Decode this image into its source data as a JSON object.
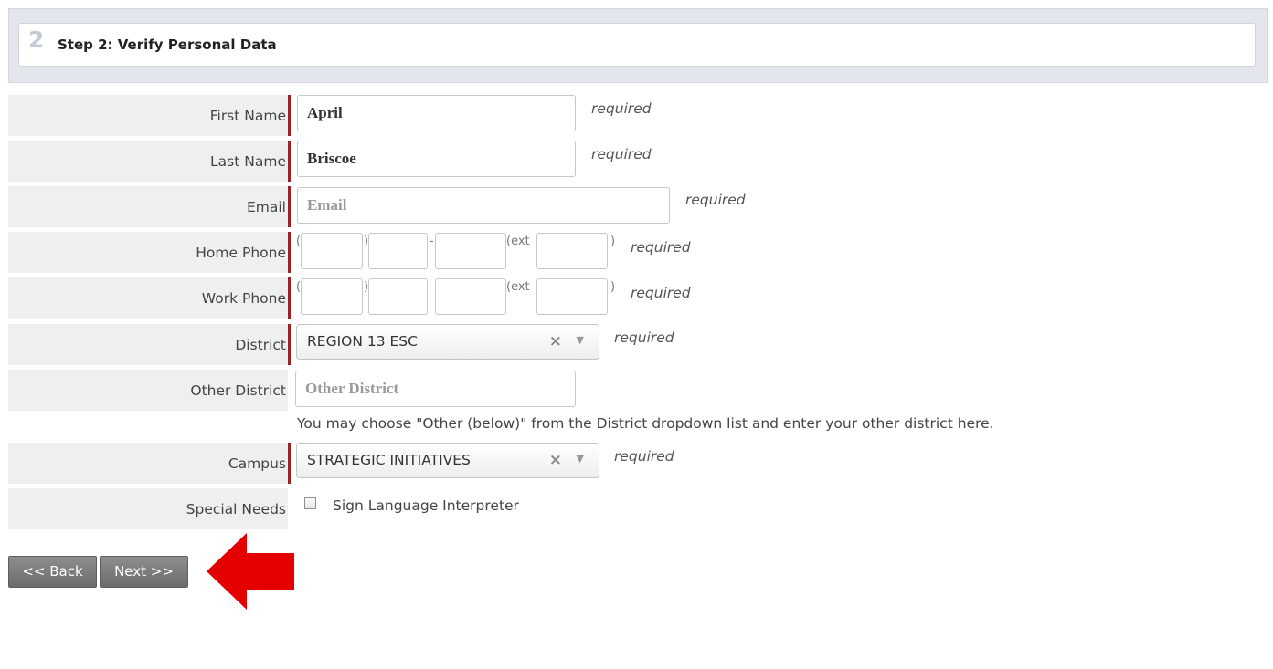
{
  "step": {
    "number": "2",
    "title": "Step 2: Verify Personal Data"
  },
  "form": {
    "first_name": {
      "label": "First Name",
      "value": "April",
      "note": "required"
    },
    "last_name": {
      "label": "Last Name",
      "value": "Briscoe",
      "note": "required"
    },
    "email": {
      "label": "Email",
      "placeholder": "Email",
      "note": "required"
    },
    "home_phone": {
      "label": "Home Phone",
      "open": "(",
      "close": ")",
      "dash": "-",
      "ext": "(ext",
      "ext_close": ")",
      "note": "required"
    },
    "work_phone": {
      "label": "Work Phone",
      "open": "(",
      "close": ")",
      "dash": "-",
      "ext": "(ext",
      "ext_close": ")",
      "note": "required"
    },
    "district": {
      "label": "District",
      "value": "REGION 13 ESC",
      "note": "required"
    },
    "other_district": {
      "label": "Other District",
      "placeholder": "Other District",
      "hint": "You may choose \"Other (below)\" from the District dropdown list and enter your other district here."
    },
    "campus": {
      "label": "Campus",
      "value": "STRATEGIC INITIATIVES",
      "note": "required"
    },
    "special_needs": {
      "label": "Special Needs",
      "option": "Sign Language Interpreter"
    }
  },
  "buttons": {
    "back": "<< Back",
    "next": "Next >>"
  },
  "icons": {
    "clear": "×",
    "dropdown": "▼"
  },
  "colors": {
    "required_bar": "#9b2226",
    "arrow": "#e50000",
    "button": "#7a7a7a"
  }
}
